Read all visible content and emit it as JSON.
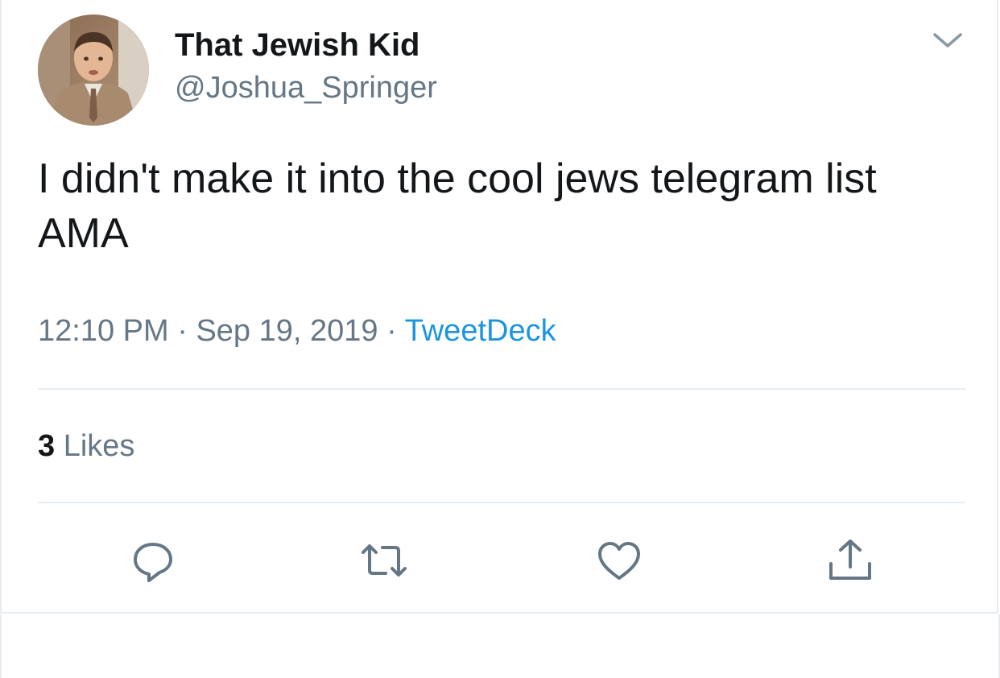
{
  "user": {
    "display_name": "That Jewish Kid",
    "handle": "@Joshua_Springer"
  },
  "tweet": {
    "text": "I didn't make it into the cool jews telegram list AMA",
    "time": "12:10 PM",
    "date": "Sep 19, 2019",
    "separator": "·",
    "source": "TweetDeck"
  },
  "stats": {
    "likes_count": "3",
    "likes_label": "Likes"
  },
  "actions": {
    "icons": [
      "reply-icon",
      "retweet-icon",
      "like-icon",
      "share-icon"
    ]
  },
  "colors": {
    "text_primary": "#14171a",
    "text_secondary": "#657786",
    "link": "#1b95e0",
    "divider": "#e6ecf0",
    "icon": "#657786"
  }
}
